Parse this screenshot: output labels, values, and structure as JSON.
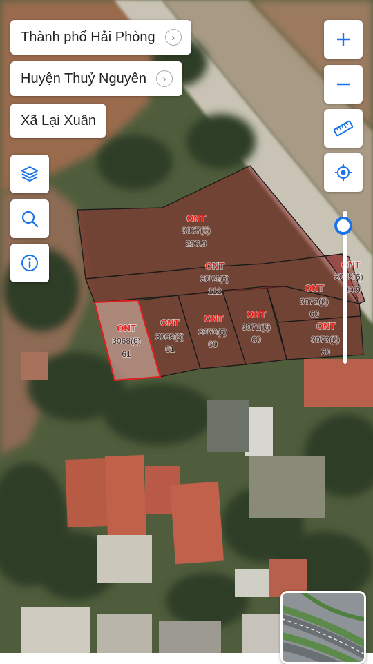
{
  "breadcrumbs": {
    "city": "Thành phố Hải Phòng",
    "district": "Huyện Thuỷ Nguyên",
    "commune": "Xã Lại Xuân"
  },
  "colors": {
    "accent": "#1a73e8",
    "parcel_fill": "#8b2f2f",
    "parcel_border": "#1a1a1a",
    "selected_border": "#e02020",
    "label_land_type": "#e8201c"
  },
  "tools_left": [
    "layers-icon",
    "search-icon",
    "info-icon"
  ],
  "tools_right": [
    "zoom-in-icon",
    "zoom-out-icon",
    "ruler-icon",
    "locate-icon"
  ],
  "zoom_level_fraction": 0.9,
  "parcels": [
    {
      "id": "3067",
      "land_type": "ONT",
      "number": "3067(6)",
      "area": "296.9",
      "selected": false
    },
    {
      "id": "3074",
      "land_type": "ONT",
      "number": "3074(6)",
      "area": "112",
      "selected": false
    },
    {
      "id": "3075",
      "land_type": "ONT",
      "number": "3075(6)",
      "area": "90.9",
      "selected": false
    },
    {
      "id": "3068",
      "land_type": "ONT",
      "number": "3068(6)",
      "area": "61",
      "selected": true
    },
    {
      "id": "3069",
      "land_type": "ONT",
      "number": "3069(6)",
      "area": "61",
      "selected": false
    },
    {
      "id": "3070",
      "land_type": "ONT",
      "number": "3070(6)",
      "area": "60",
      "selected": false
    },
    {
      "id": "3071",
      "land_type": "ONT",
      "number": "3071(6)",
      "area": "60",
      "selected": false
    },
    {
      "id": "3072",
      "land_type": "ONT",
      "number": "3072(6)",
      "area": "60",
      "selected": false
    },
    {
      "id": "3073",
      "land_type": "ONT",
      "number": "3073(6)",
      "area": "60",
      "selected": false
    }
  ]
}
